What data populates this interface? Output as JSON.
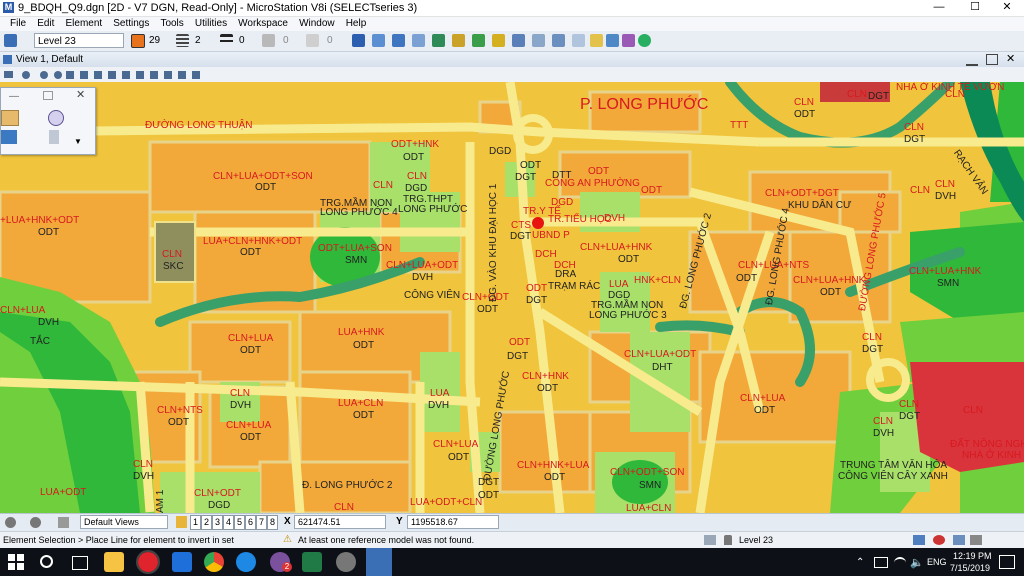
{
  "app": {
    "window_title": "9_BDQH_Q9.dgn [2D - V7 DGN, Read-Only] - MicroStation V8i (SELECTseries 3)",
    "icon_letter": "M"
  },
  "window_buttons": {
    "minimize": "—",
    "maximize": "☐",
    "close": "✕"
  },
  "menu": [
    "File",
    "Edit",
    "Element",
    "Settings",
    "Tools",
    "Utilities",
    "Workspace",
    "Window",
    "Help"
  ],
  "attributes": {
    "level": "Level 23",
    "color": "29",
    "color_hex": "#e8731c",
    "line_style": "2",
    "weight": "0",
    "transparency": "0",
    "priority": "0"
  },
  "view": {
    "title": "View 1, Default"
  },
  "map_labels": {
    "p_long_phuoc": "P. LONG PHƯỚC",
    "duong_long_thuan": "ĐƯỜNG LONG THUẬN",
    "cln_lua_odt_son": "CLN+LUA+ODT+SON",
    "odt": "ODT",
    "odt_hnk": "ODT+HNK",
    "cln": "CLN",
    "dgd": "DGD",
    "trg_thpt": "TRG.THPT",
    "long_phuoc": "LONG PHƯỚC",
    "trg_mam_non": "TRG.MẦM NON",
    "long_phuoc_4": "LONG PHƯỚC 4",
    "lua_hnk_odt": "+LUA+HNK+ODT",
    "skc": "SKC",
    "lua_cln_hnk_odt": "LUA+CLN+HNK+ODT",
    "odt_lua_son": "ODT+LUA+SON",
    "smn": "SMN",
    "cln_lua_odt": "CLN+LUA+ODT",
    "dvh": "DVH",
    "cong_vien": "CÔNG VIÊN",
    "cln_odt": "CLN+ODT",
    "cln_lua": "CLN+LUA",
    "tac": "TẮC",
    "lua_hnk": "LUA+HNK",
    "lua_cln": "LUA+CLN",
    "lua": "LUA",
    "cln_nts": "CLN+NTS",
    "cln_hnk": "CLN+HNK",
    "cln_hnk_lua": "CLN+HNK+LUA",
    "lua_odt": "LUA+ODT",
    "cln_odt_son": "CLN+ODT+SON",
    "dgt": "DGT",
    "dtt": "DTT",
    "cong_an_phuong": "CÔNG AN PHƯỜNG",
    "tr_y_te": "TR.Y TẾ",
    "cts": "CTS",
    "ubnd_p": "UBND P",
    "tr_tieu_hoc": "TR.TIỂU HỌC",
    "dch": "DCH",
    "dra": "DRA",
    "tram_rac": "TRẠM RÁC",
    "cln_lua_hnk": "CLN+LUA+HNK",
    "hnk_cln": "HNK+CLN",
    "trg_mam_non_lp3": "LONG PHƯỚC 3",
    "cln_lua_odt2": "CLN+LUA+ODT",
    "dht": "DHT",
    "cln_odt_dgt": "CLN+ODT+DGT",
    "khu_dan_cu": "KHU DÂN CƯ",
    "cln_lua_nts": "CLN+LUA+NTS",
    "cln_lua_hnk2": "CLN+LUA+HNK",
    "cln_lua_hnk_smn": "CLN+LUA+HNK",
    "rach_van": "RẠCH VẢN",
    "dat_nong_nghiep": "ĐẤT NÔNG NGHIỆP",
    "nha_o_kinh_te": "NHÀ Ở KINH TẾ",
    "nha_o_kinh_te_vuon": "NHÀ Ở KINH TẾ VƯỜN",
    "trung_tam_van_hoa": "TRUNG TÂM VĂN HÓA",
    "cong_vien_cay_xanh": "CÔNG VIÊN CÂY XANH",
    "d_long_phuoc_2": "Đ. LONG PHƯỚC 2",
    "dg_vao_khu_dai_hoc": "ĐG. VÀO KHU ĐẠI HỌC 1",
    "dg_long_phuoc_2": "ĐG. LONG PHƯỚC 2",
    "duong_long_phuoc": "ĐƯỜNG LONG PHƯỚC",
    "dg_long_phuoc_4": "ĐG. LONG PHƯỚC 4",
    "duong_long_phuoc_5": "ĐƯỜNG LONG PHƯỚC 5",
    "tr_label": "TR",
    "lua_odt_cln": "LUA+ODT+CLN",
    "lua_cln2": "LUA+CLN",
    "a1": "AM 1",
    "ttt": "TTT"
  },
  "view_controls": {
    "saved_views": "Default Views",
    "view_numbers": [
      "1",
      "2",
      "3",
      "4",
      "5",
      "6",
      "7",
      "8"
    ],
    "x_label": "X",
    "x_value": "621474.51",
    "y_label": "Y",
    "y_value": "1195518.67"
  },
  "status": {
    "prompt": "Element Selection > Place Line for element to invert in set",
    "message": "At least one reference model was not found.",
    "level": "Level 23"
  },
  "taskbar": {
    "language": "ENG",
    "time": "12:19 PM",
    "date": "7/15/2019",
    "notification_badge": "2"
  }
}
